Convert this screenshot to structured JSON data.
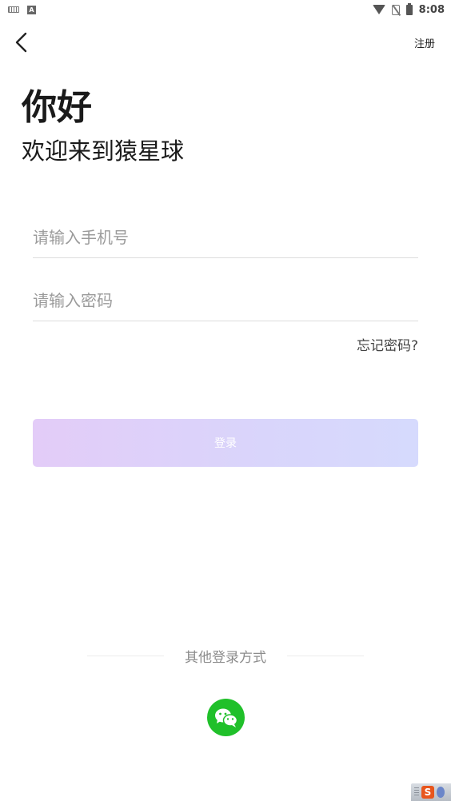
{
  "status_bar": {
    "time": "8:08",
    "icons": [
      "keyboard-icon",
      "a-icon",
      "wifi-icon",
      "no-sim-icon",
      "battery-icon"
    ]
  },
  "header": {
    "back_icon": "chevron-left-icon",
    "register_label": "注册"
  },
  "main": {
    "greeting": "你好",
    "welcome": "欢迎来到猿星球",
    "phone_placeholder": "请输入手机号",
    "phone_value": "",
    "password_placeholder": "请输入密码",
    "password_value": "",
    "forgot_label": "忘记密码?",
    "login_label": "登录"
  },
  "footer": {
    "other_login_label": "其他登录方式",
    "wechat_icon": "wechat-icon"
  },
  "colors": {
    "wechat_green": "#20c02a",
    "login_gradient_start": "#e3ccf8",
    "login_gradient_end": "#d6dafd"
  }
}
